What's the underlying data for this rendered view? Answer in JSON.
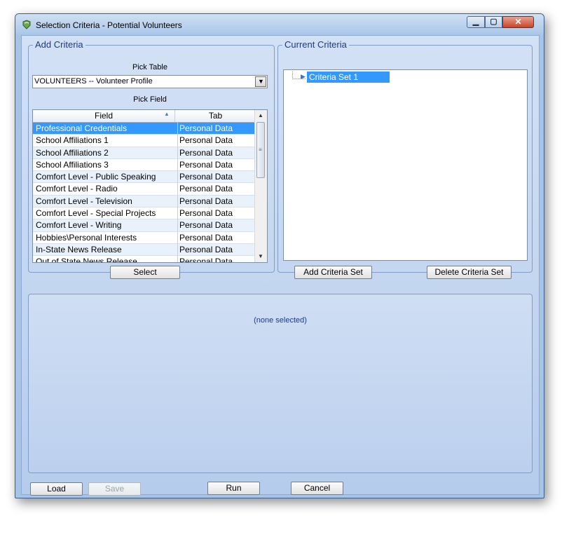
{
  "window": {
    "title": "Selection Criteria - Potential Volunteers"
  },
  "add_criteria": {
    "label": "Add Criteria",
    "pick_table_label": "Pick Table",
    "pick_table_value": "VOLUNTEERS -- Volunteer Profile",
    "pick_field_label": "Pick Field",
    "columns": {
      "field": "Field",
      "tab": "Tab"
    },
    "rows": [
      {
        "field": "Professional Credentials",
        "tab": "Personal Data"
      },
      {
        "field": "School Affiliations 1",
        "tab": "Personal Data"
      },
      {
        "field": "School Affiliations 2",
        "tab": "Personal Data"
      },
      {
        "field": "School Affiliations 3",
        "tab": "Personal Data"
      },
      {
        "field": "Comfort Level - Public Speaking",
        "tab": "Personal Data"
      },
      {
        "field": "Comfort Level - Radio",
        "tab": "Personal Data"
      },
      {
        "field": "Comfort Level - Television",
        "tab": "Personal Data"
      },
      {
        "field": "Comfort Level - Special Projects",
        "tab": "Personal Data"
      },
      {
        "field": "Comfort Level - Writing",
        "tab": "Personal Data"
      },
      {
        "field": "Hobbies\\Personal Interests",
        "tab": "Personal Data"
      },
      {
        "field": "In-State News Release",
        "tab": "Personal Data"
      },
      {
        "field": "Out of State News Release",
        "tab": "Personal Data"
      }
    ],
    "select_button": "Select"
  },
  "current_criteria": {
    "label": "Current Criteria",
    "tree_node": "Criteria Set 1",
    "add_button": "Add Criteria Set",
    "delete_button": "Delete Criteria Set"
  },
  "details": {
    "empty_text": "(none selected)"
  },
  "footer": {
    "load": "Load",
    "save": "Save",
    "run": "Run",
    "cancel": "Cancel"
  },
  "icons": [
    "app-icon",
    "minimize-icon",
    "maximize-icon",
    "close-icon",
    "dropdown-arrow-icon",
    "sort-ascending-icon",
    "scroll-up-icon",
    "scroll-down-icon",
    "tree-node-icon"
  ],
  "colors": {
    "selection": "#3399ff",
    "group_label": "#1d3a8a",
    "window_frame": "#a7c4e6"
  }
}
